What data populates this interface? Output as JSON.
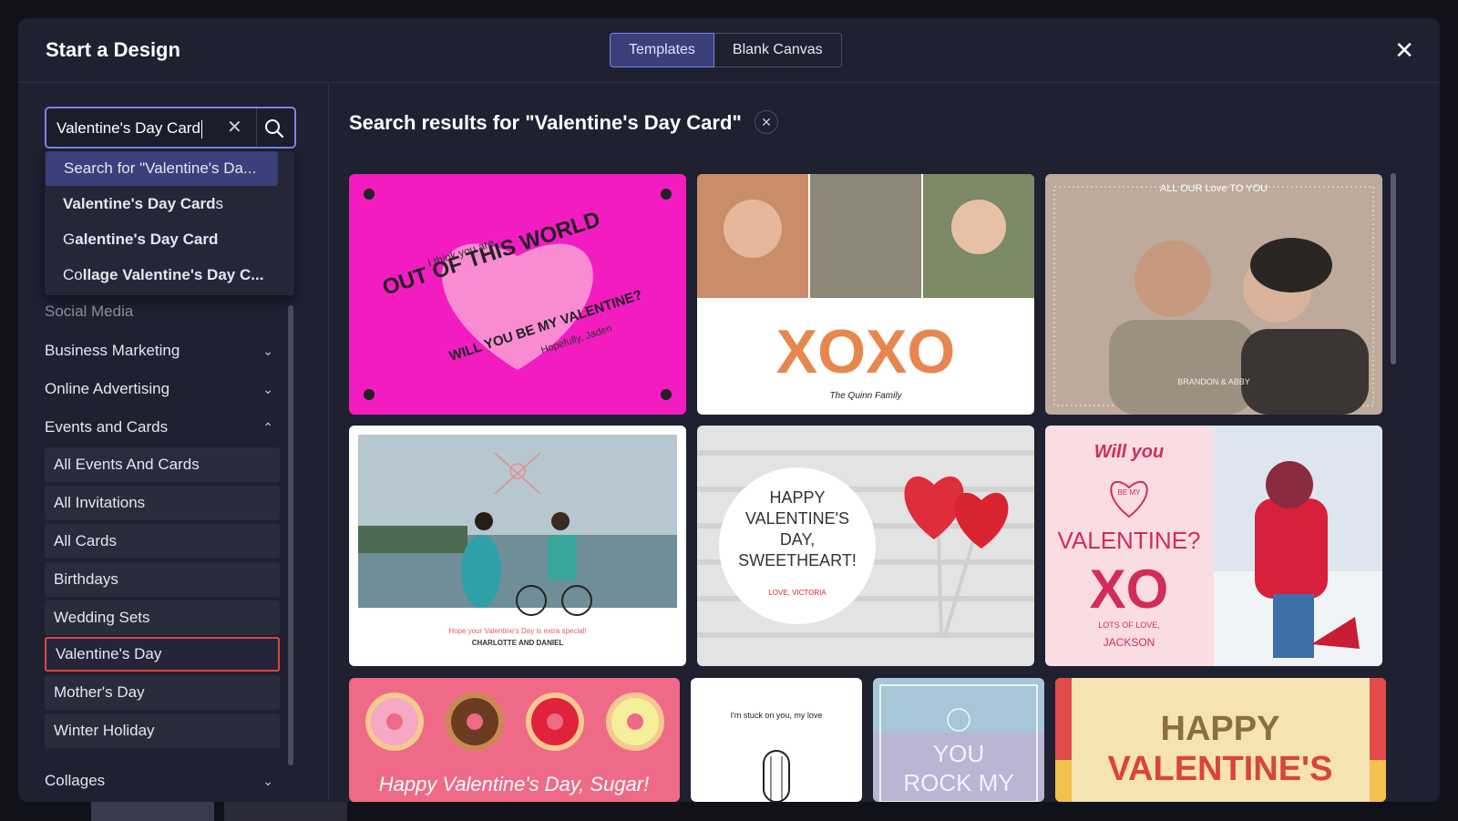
{
  "modal": {
    "title": "Start a Design",
    "close_icon": "close-icon"
  },
  "tabs": [
    {
      "label": "Templates",
      "active": true
    },
    {
      "label": "Blank Canvas",
      "active": false
    }
  ],
  "search": {
    "value": "Valentine's Day Card",
    "suggestions": [
      {
        "pre": "Search for \"Valentine's Da...",
        "bold": "",
        "post": ""
      },
      {
        "pre": "",
        "bold": "Valentine's Day Card",
        "post": "s"
      },
      {
        "pre": "G",
        "bold": "alentine's Day Card",
        "post": ""
      },
      {
        "pre": "Co",
        "bold": "llage Valentine's Day C...",
        "post": ""
      }
    ]
  },
  "sidebar": {
    "partial_category": "Social Media",
    "categories": [
      {
        "label": "Business Marketing",
        "expanded": false
      },
      {
        "label": "Online Advertising",
        "expanded": false
      },
      {
        "label": "Events and Cards",
        "expanded": true
      }
    ],
    "subitems": [
      "All Events And Cards",
      "All Invitations",
      "All Cards",
      "Birthdays",
      "Wedding Sets",
      "Valentine's Day",
      "Mother's Day",
      "Winter Holiday"
    ],
    "selected_subitem": "Valentine's Day",
    "last_category": "Collages"
  },
  "results": {
    "title": "Search results for \"Valentine's Day Card\"",
    "cards": {
      "c1": {
        "line1": "I think you are",
        "line2": "OUT OF THIS WORLD",
        "line3": "WILL YOU BE MY VALENTINE?",
        "line4": "Hopefully, Jaden"
      },
      "c2": {
        "big": "XOXO",
        "sign": "The Quinn Family"
      },
      "c3": {
        "top": "ALL OUR Love TO YOU",
        "names": "BRANDON & ABBY"
      },
      "c4": {
        "note": "Hope your Valentine's Day is extra special!",
        "names": "CHARLOTTE AND DANIEL"
      },
      "c5": {
        "l1": "HAPPY",
        "l2": "VALENTINE'S",
        "l3": "DAY,",
        "l4": "SWEETHEART!",
        "sign": "LOVE, VICTORIA"
      },
      "c6": {
        "l1": "Will you",
        "l2": "BE MY",
        "l3": "VALENTINE?",
        "l4": "XO",
        "l5": "LOTS OF LOVE,",
        "l6": "JACKSON"
      },
      "c7": {
        "text": "Happy Valentine's Day, Sugar!"
      },
      "c8": {
        "text": "I'm stuck on you, my love"
      },
      "c9": {
        "l1": "YOU",
        "l2": "ROCK MY"
      },
      "c10": {
        "l1": "HAPPY",
        "l2": "VALENTINE'S"
      }
    }
  },
  "colors": {
    "accent": "#7c82ee",
    "selected_border": "#e0453a",
    "modal_bg": "#1f2030"
  }
}
